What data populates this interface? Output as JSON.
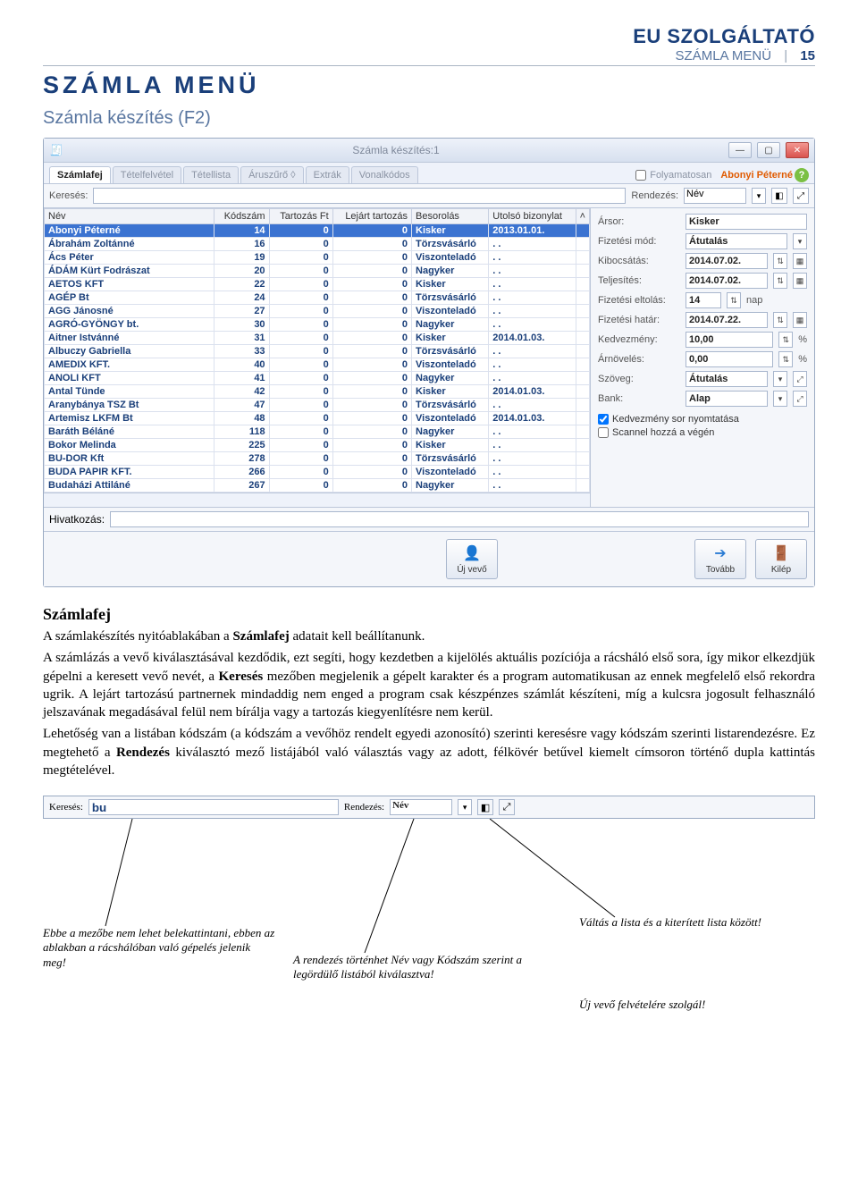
{
  "header": {
    "brand": "EU SZOLGÁLTATÓ",
    "section": "SZÁMLA MENÜ",
    "page": "15"
  },
  "h1": "SZÁMLA MENÜ",
  "h2": "Számla készítés (F2)",
  "win": {
    "title": "Számla készítés:1",
    "tabs": [
      "Számlafej",
      "Tételfelvétel",
      "Tétellista",
      "Áruszűrő ◊",
      "Extrák",
      "Vonalkódos"
    ],
    "folyamatosan": "Folyamatosan",
    "customer": "Abonyi Péterné",
    "search_label": "Keresés:",
    "rendezes_label": "Rendezés:",
    "rendezes_value": "Név",
    "columns": [
      "Név",
      "Kódszám",
      "Tartozás Ft",
      "Lejárt tartozás",
      "Besorolás",
      "Utolsó bizonylat"
    ],
    "rows": [
      {
        "n": "Abonyi Péterné",
        "k": "14",
        "t": "0",
        "l": "0",
        "b": "Kisker",
        "u": "2013.01.01."
      },
      {
        "n": "Ábrahám Zoltánné",
        "k": "16",
        "t": "0",
        "l": "0",
        "b": "Törzsvásárló",
        "u": ". ."
      },
      {
        "n": "Ács Péter",
        "k": "19",
        "t": "0",
        "l": "0",
        "b": "Viszonteladó",
        "u": ". ."
      },
      {
        "n": "ÁDÁM Kürt Fodrászat",
        "k": "20",
        "t": "0",
        "l": "0",
        "b": "Nagyker",
        "u": ". ."
      },
      {
        "n": "AETOS KFT",
        "k": "22",
        "t": "0",
        "l": "0",
        "b": "Kisker",
        "u": ". ."
      },
      {
        "n": "AGÉP Bt",
        "k": "24",
        "t": "0",
        "l": "0",
        "b": "Törzsvásárló",
        "u": ". ."
      },
      {
        "n": "AGG Jánosné",
        "k": "27",
        "t": "0",
        "l": "0",
        "b": "Viszonteladó",
        "u": ". ."
      },
      {
        "n": "AGRÓ-GYÖNGY bt.",
        "k": "30",
        "t": "0",
        "l": "0",
        "b": "Nagyker",
        "u": ". ."
      },
      {
        "n": "Aitner Istvánné",
        "k": "31",
        "t": "0",
        "l": "0",
        "b": "Kisker",
        "u": "2014.01.03."
      },
      {
        "n": "Albuczy Gabriella",
        "k": "33",
        "t": "0",
        "l": "0",
        "b": "Törzsvásárló",
        "u": ". ."
      },
      {
        "n": "AMEDIX KFT.",
        "k": "40",
        "t": "0",
        "l": "0",
        "b": "Viszonteladó",
        "u": ". ."
      },
      {
        "n": "ANOLI KFT",
        "k": "41",
        "t": "0",
        "l": "0",
        "b": "Nagyker",
        "u": ". ."
      },
      {
        "n": "Antal Tünde",
        "k": "42",
        "t": "0",
        "l": "0",
        "b": "Kisker",
        "u": "2014.01.03."
      },
      {
        "n": "Aranybánya TSZ Bt",
        "k": "47",
        "t": "0",
        "l": "0",
        "b": "Törzsvásárló",
        "u": ". ."
      },
      {
        "n": "Artemisz LKFM Bt",
        "k": "48",
        "t": "0",
        "l": "0",
        "b": "Viszonteladó",
        "u": "2014.01.03."
      },
      {
        "n": "Baráth Béláné",
        "k": "118",
        "t": "0",
        "l": "0",
        "b": "Nagyker",
        "u": ". ."
      },
      {
        "n": "Bokor Melinda",
        "k": "225",
        "t": "0",
        "l": "0",
        "b": "Kisker",
        "u": ". ."
      },
      {
        "n": "BU-DOR Kft",
        "k": "278",
        "t": "0",
        "l": "0",
        "b": "Törzsvásárló",
        "u": ". ."
      },
      {
        "n": "BUDA PAPIR KFT.",
        "k": "266",
        "t": "0",
        "l": "0",
        "b": "Viszonteladó",
        "u": ". ."
      },
      {
        "n": "Budaházi Attiláné",
        "k": "267",
        "t": "0",
        "l": "0",
        "b": "Nagyker",
        "u": ". ."
      }
    ],
    "side": {
      "arsor_l": "Ársor:",
      "arsor_v": "Kisker",
      "fizmod_l": "Fizetési mód:",
      "fizmod_v": "Átutalás",
      "kibocs_l": "Kibocsátás:",
      "kibocs_v": "2014.07.02.",
      "telj_l": "Teljesítés:",
      "telj_v": "2014.07.02.",
      "eltol_l": "Fizetési eltolás:",
      "eltol_v": "14",
      "eltol_u": "nap",
      "hatar_l": "Fizetési határ:",
      "hatar_v": "2014.07.22.",
      "kedv_l": "Kedvezmény:",
      "kedv_v": "10,00",
      "kedv_u": "%",
      "arnov_l": "Árnövelés:",
      "arnov_v": "0,00",
      "arnov_u": "%",
      "szov_l": "Szöveg:",
      "szov_v": "Átutalás",
      "bank_l": "Bank:",
      "bank_v": "Alap",
      "chk1": "Kedvezmény sor nyomtatása",
      "chk2": "Scannel hozzá a végén"
    },
    "hivatkozas": "Hivatkozás:",
    "btn_ujvevo": "Új vevő",
    "btn_tovabb": "Tovább",
    "btn_kilep": "Kilép"
  },
  "doc": {
    "h3": "Számlafej",
    "p1a": "A számlakészítés nyitóablakában a ",
    "p1b": "Számlafej",
    "p1c": " adatait kell beállítanunk.",
    "p2a": "A számlázás a vevő kiválasztásával kezdődik, ezt segíti, hogy kezdetben a kijelölés aktuális pozíciója a rácsháló első sora, így mikor elkezdjük gépelni a keresett vevő nevét, a ",
    "p2b": "Keresés",
    "p2c": " mezőben megjelenik a gépelt karakter és a program automatikusan az ennek megfelelő első rekordra ugrik. A lejárt tartozású partnernek mindaddig nem enged a program csak készpénzes számlát készíteni, míg a kulcsra jogosult felhasználó jelszavának megadásával felül nem bírálja vagy a tartozás kiegyenlítésre nem kerül.",
    "p3a": "Lehetőség van a listában kódszám (a kódszám a vevőhöz rendelt egyedi azonosító) szerinti keresésre vagy kódszám szerinti listarendezésre. Ez megtehető a ",
    "p3b": "Rendezés",
    "p3c": " kiválasztó mező listájából való választás vagy az adott, félkövér betűvel kiemelt címsoron történő dupla kattintás megtételével."
  },
  "strip": {
    "keres_l": "Keresés:",
    "keres_v": "bu",
    "rend_l": "Rendezés:",
    "rend_v": "Név"
  },
  "callouts": {
    "c1": "Ebbe a mezőbe nem lehet belekattintani, ebben az ablakban a rácshálóban való gépelés jelenik meg!",
    "c2": "A rendezés történhet Név vagy Kódszám szerint a legördülő listából kiválasztva!",
    "c3": "Váltás a lista és a kiterített lista között!",
    "c4": "Új vevő felvételére szolgál!"
  }
}
